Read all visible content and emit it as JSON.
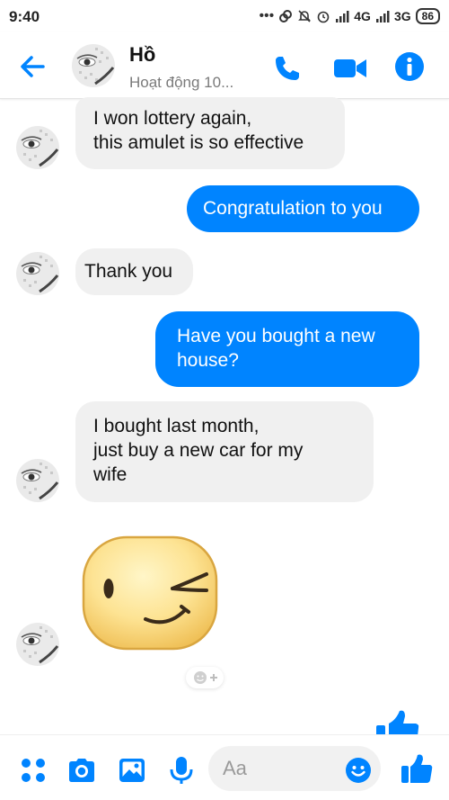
{
  "status_bar": {
    "time": "9:40",
    "network_1": "4G",
    "network_2": "3G",
    "battery": "86",
    "icons": [
      "dots-icon",
      "link-icon",
      "bell-off-icon",
      "alarm-icon",
      "signal-icon",
      "signal-icon"
    ]
  },
  "header": {
    "name": "Hồ",
    "status": "Hoạt động 10...",
    "accent": "#0084ff",
    "icons": [
      "back-arrow-icon",
      "phone-icon",
      "video-camera-icon",
      "info-icon"
    ]
  },
  "messages": [
    {
      "direction": "incoming",
      "lines": [
        "I won lottery again,",
        "this amulet is so effective"
      ]
    },
    {
      "direction": "outgoing",
      "lines": [
        "Congratulation to you"
      ]
    },
    {
      "direction": "incoming",
      "lines": [
        "Thank you"
      ]
    },
    {
      "direction": "outgoing",
      "lines": [
        "Have you bought a new",
        "house?"
      ]
    },
    {
      "direction": "incoming",
      "lines": [
        "I bought last month,",
        "just buy a new car for my",
        "wife"
      ]
    },
    {
      "direction": "incoming",
      "sticker": "winking-face-emoji"
    }
  ],
  "reaction_button": "add-reaction-icon",
  "composer": {
    "placeholder": "Aa",
    "tools": [
      "apps-icon",
      "camera-icon",
      "image-icon",
      "microphone-icon",
      "emoji-icon",
      "thumbs-up-icon"
    ]
  },
  "colors": {
    "outgoing_bubble": "#0084ff",
    "incoming_bubble": "#f0f0f0"
  }
}
